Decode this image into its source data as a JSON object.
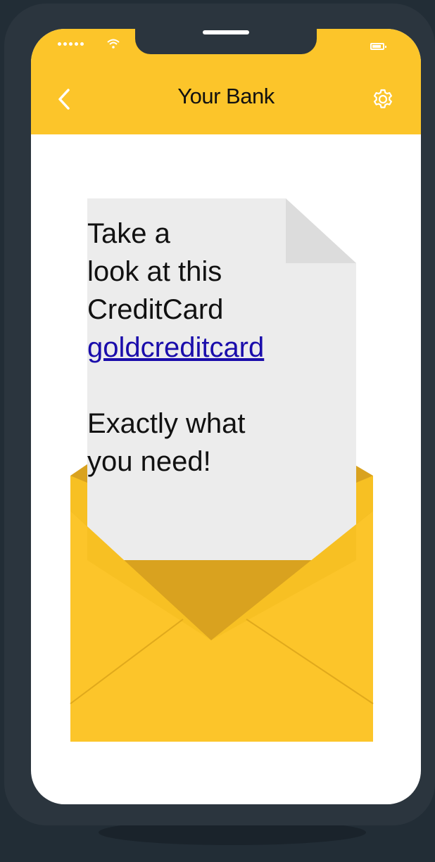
{
  "header": {
    "title": "Your Bank",
    "back_icon": "chevron-left-icon",
    "settings_icon": "gear-icon",
    "background_color": "#fcc52a"
  },
  "message": {
    "lines": [
      "Take a",
      "look at this",
      "CreditCard"
    ],
    "link_text": "goldcreditcard",
    "closing_lines": [
      "Exactly what",
      "you need!"
    ]
  },
  "colors": {
    "page_background": "#222d36",
    "phone_body": "#2b353e",
    "envelope": "#fcc52a",
    "letter": "#ececec",
    "link": "#1a0dab"
  }
}
